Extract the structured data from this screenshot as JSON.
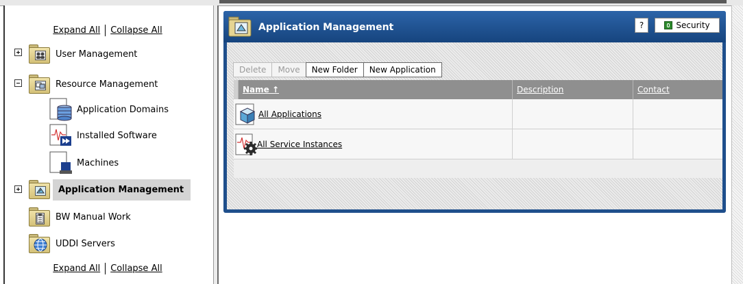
{
  "tree": {
    "expand_all": "Expand All",
    "collapse_all": "Collapse All",
    "items": [
      {
        "label": "User Management"
      },
      {
        "label": "Resource Management"
      },
      {
        "label": "Application Domains"
      },
      {
        "label": "Installed Software"
      },
      {
        "label": "Machines"
      },
      {
        "label": "Application Management"
      },
      {
        "label": "BW Manual Work"
      },
      {
        "label": "UDDI Servers"
      }
    ]
  },
  "panel": {
    "title": "Application Management",
    "help_label": "?",
    "security_label": "Security",
    "toolbar": {
      "delete": "Delete",
      "move": "Move",
      "new_folder": "New Folder",
      "new_application": "New Application"
    },
    "table": {
      "columns": {
        "name": "Name ↑",
        "description": "Description",
        "contact": "Contact"
      },
      "rows": [
        {
          "name": "All Applications",
          "description": "",
          "contact": ""
        },
        {
          "name": "All Service Instances",
          "description": "",
          "contact": ""
        }
      ]
    }
  },
  "colors": {
    "panel_header": "#1f4f8c",
    "selected_item_bg": "#d4d4d4",
    "grid_header": "#8f8f8f",
    "folder": "#e4d38c"
  }
}
